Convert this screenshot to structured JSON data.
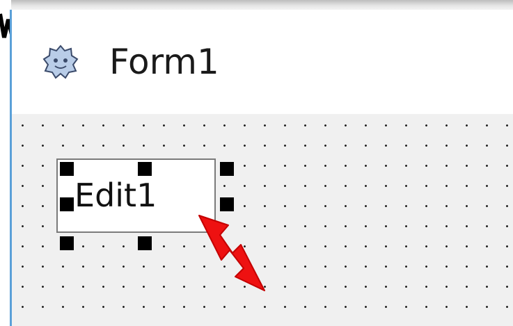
{
  "form": {
    "title": "Form1",
    "icon": "form-gear-icon"
  },
  "edit_control": {
    "text": "Edit1",
    "selected": true
  },
  "annotation": {
    "icon": "red-resize-arrow-icon",
    "color": "#ee1111"
  },
  "colors": {
    "window_border": "#5aa0d8",
    "surface": "#f0f0f0",
    "grid_dot": "#222222"
  }
}
